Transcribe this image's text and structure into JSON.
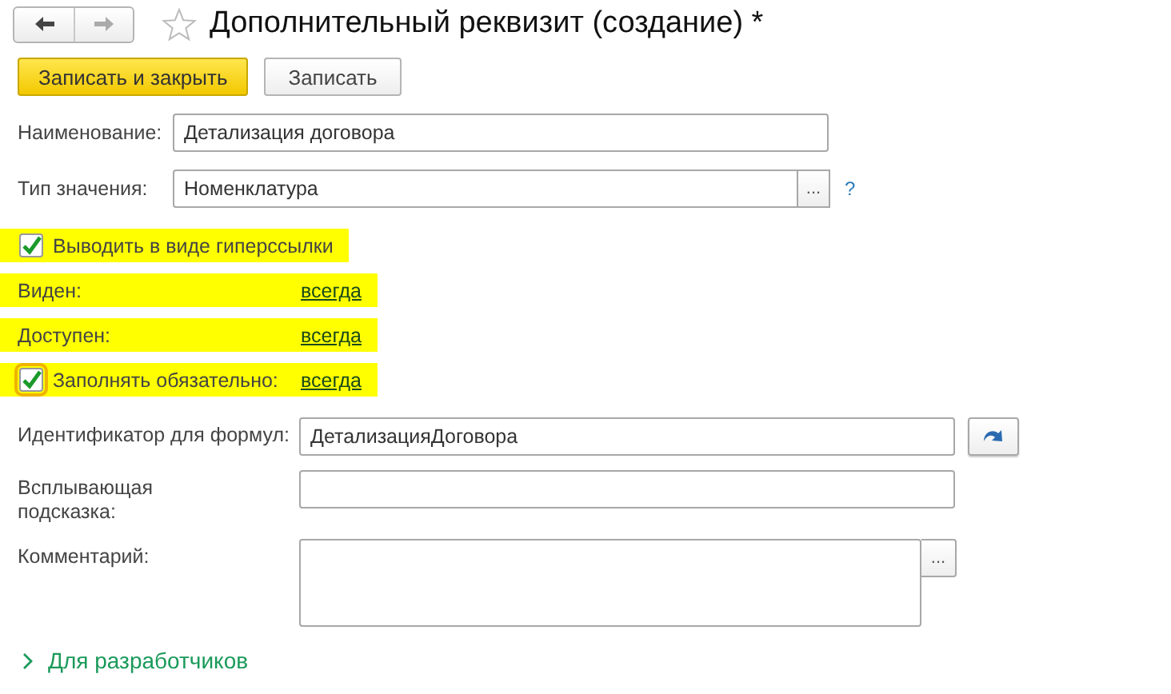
{
  "header": {
    "title": "Дополнительный реквизит (создание) *",
    "favorite": false
  },
  "toolbar": {
    "buttons": [
      {
        "label": "Записать и закрыть",
        "kind": "primary"
      },
      {
        "label": "Записать",
        "kind": "default"
      }
    ]
  },
  "main_fields": [
    {
      "kind": "input",
      "label": "Наименование:",
      "value": "Детализация договора"
    },
    {
      "kind": "choice",
      "label": "Тип значения:",
      "value": "Номенклатура",
      "choose_button": "...",
      "help": "?"
    }
  ],
  "options": [
    {
      "kind": "checkbox",
      "label": "Выводить в виде гиперссылки",
      "checked": true,
      "highlighted": true
    },
    {
      "kind": "link",
      "label": "Виден:",
      "link": "всегда",
      "highlighted": true
    },
    {
      "kind": "link",
      "label": "Доступен:",
      "link": "всегда",
      "highlighted": true
    },
    {
      "kind": "check-link",
      "label": "Заполнять обязательно:",
      "checked": true,
      "focused": true,
      "link": "всегда",
      "highlighted": true
    }
  ],
  "details": [
    {
      "kind": "input-action",
      "label": "Идентификатор для формул:",
      "value": "ДетализацияДоговора"
    },
    {
      "kind": "input",
      "label": "Всплывающая подсказка:"
    },
    {
      "kind": "textarea",
      "label": "Комментарий:",
      "choose_button": "..."
    }
  ],
  "footer": {
    "label": "Для разработчиков",
    "expanded": false
  }
}
